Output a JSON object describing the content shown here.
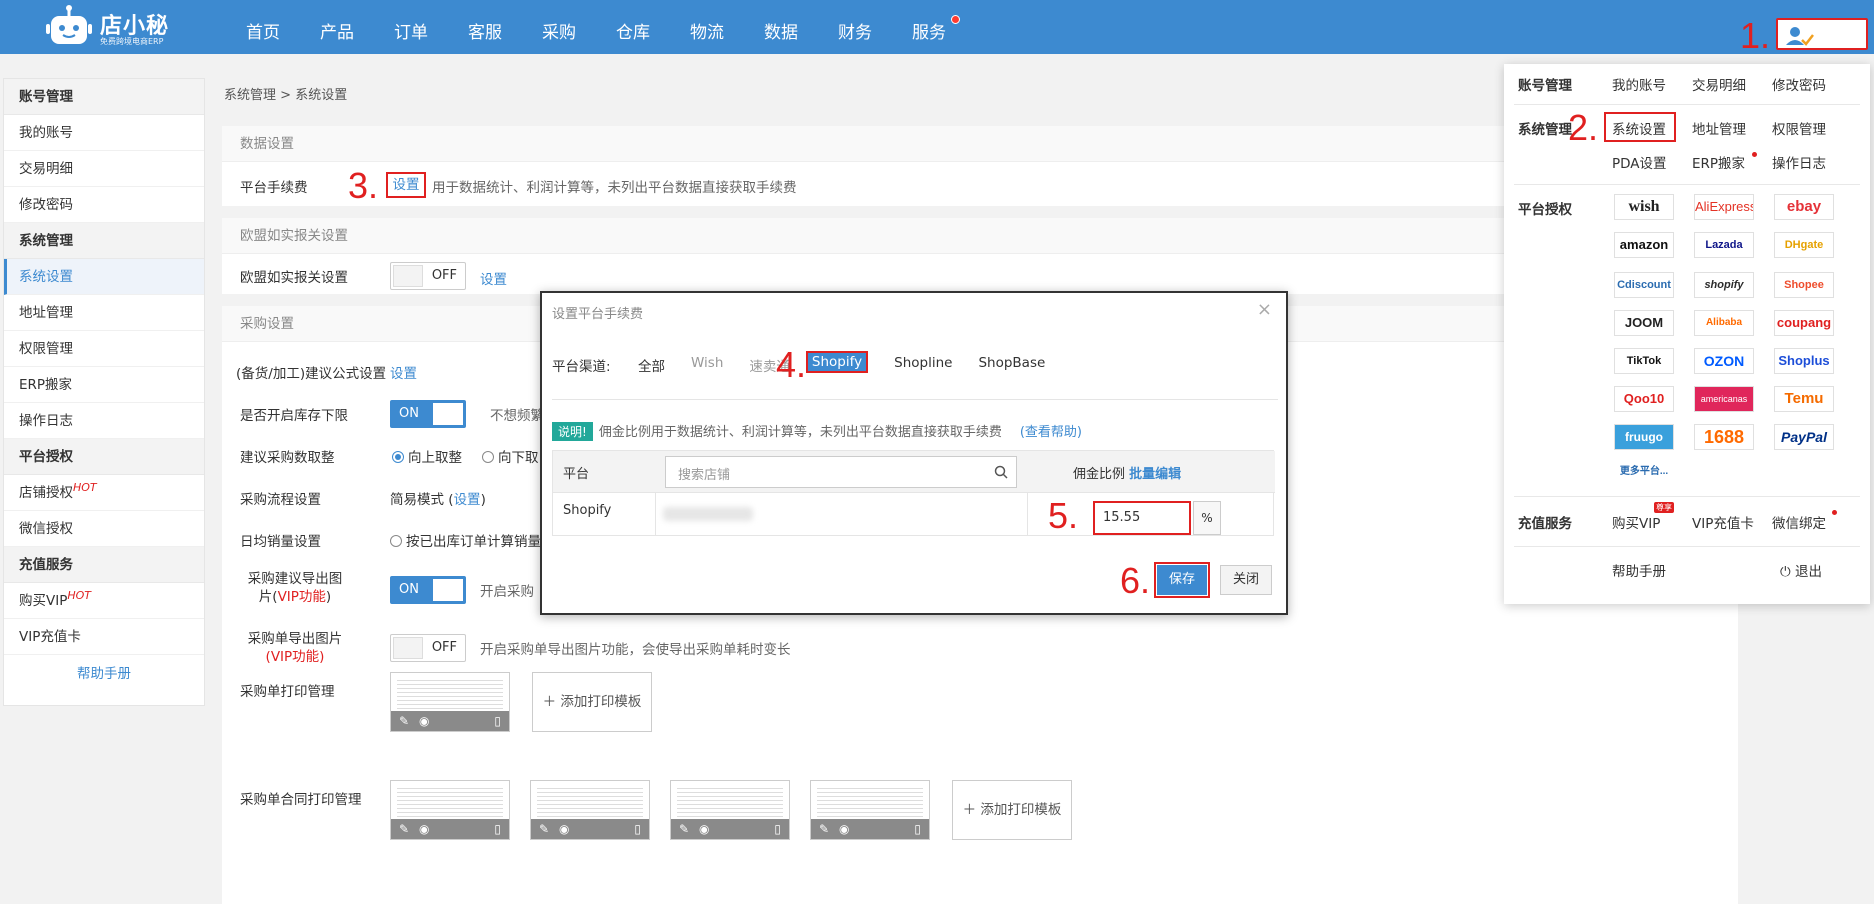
{
  "logo": {
    "brand": "店小秘",
    "sub": "免费跨境电商ERP"
  },
  "nav": [
    "首页",
    "产品",
    "订单",
    "客服",
    "采购",
    "仓库",
    "物流",
    "数据",
    "财务",
    "服务"
  ],
  "steps": [
    "1.",
    "2.",
    "3.",
    "4.",
    "5.",
    "6."
  ],
  "sidebar": {
    "groups": [
      {
        "title": "账号管理",
        "items": [
          "我的账号",
          "交易明细",
          "修改密码"
        ]
      },
      {
        "title": "系统管理",
        "items": [
          "系统设置",
          "地址管理",
          "权限管理",
          "ERP搬家",
          "操作日志"
        ]
      },
      {
        "title": "平台授权",
        "items": [
          "店铺授权",
          "微信授权"
        ]
      },
      {
        "title": "充值服务",
        "items": [
          "购买VIP",
          "VIP充值卡"
        ]
      }
    ],
    "hot": "HOT",
    "help": "帮助手册"
  },
  "breadcrumb": {
    "parent": "系统管理",
    "sep": ">",
    "current": "系统设置"
  },
  "data_settings": {
    "title": "数据设置",
    "fee_label": "平台手续费",
    "fee_link": "设置",
    "fee_desc": "用于数据统计、利润计算等，未列出平台数据直接获取手续费"
  },
  "eu_settings": {
    "title": "欧盟如实报关设置",
    "label": "欧盟如实报关设置",
    "toggle": "OFF",
    "link": "设置"
  },
  "purchase": {
    "title": "采购设置",
    "formula_label": "(备货/加工)建议公式设置",
    "formula_link": "设置",
    "stock_limit_label": "是否开启库存下限",
    "stock_limit_toggle": "ON",
    "stock_limit_desc": "不想频繁",
    "rounding_label": "建议采购数取整",
    "round_up": "向上取整",
    "round_down": "向下取",
    "flow_label": "采购流程设置",
    "flow_value": "简易模式 (",
    "flow_link": "设置",
    "flow_close": ")",
    "daily_label": "日均销量设置",
    "daily_option": "按已出库订单计算销量",
    "export_img_label_1": "采购建议导出图",
    "export_img_label_2": "片(",
    "export_img_vip": "VIP功能",
    "export_img_label_3": ")",
    "export_img_toggle": "ON",
    "export_img_desc": "开启采购",
    "order_img_label": "采购单导出图片",
    "order_img_vip": "(VIP功能)",
    "order_img_toggle": "OFF",
    "order_img_desc": "开启采购单导出图片功能，会使导出采购单耗时变长",
    "print_label": "采购单打印管理",
    "contract_label": "采购单合同打印管理",
    "add_template": "添加打印模板"
  },
  "modal": {
    "title": "设置平台手续费",
    "close": "×",
    "channel_label": "平台渠道:",
    "channels": [
      "全部",
      "Wish",
      "速卖通",
      "Shopify",
      "Shopline",
      "ShopBase"
    ],
    "active_channel": "Shopify",
    "note_tag": "说明!",
    "note_text": "佣金比例用于数据统计、利润计算等，未列出平台数据直接获取手续费",
    "note_help": "(查看帮助)",
    "col_platform": "平台",
    "search_placeholder": "搜索店铺",
    "col_rate": "佣金比例",
    "batch_edit": "批量编辑",
    "row_platform": "Shopify",
    "rate_value": "15.55",
    "pct": "%",
    "save": "保存",
    "close_btn": "关闭"
  },
  "dropdown": {
    "account_label": "账号管理",
    "account_links": [
      "我的账号",
      "交易明细",
      "修改密码"
    ],
    "system_label": "系统管理",
    "system_links": [
      "系统设置",
      "地址管理",
      "权限管理",
      "PDA设置",
      "ERP搬家",
      "操作日志"
    ],
    "platform_label": "平台授权",
    "platforms": [
      "wish",
      "AliExpress",
      "ebay",
      "amazon",
      "Lazada",
      "DHgate",
      "Cdiscount",
      "shopify",
      "Shopee",
      "JOOM",
      "Alibaba",
      "coupang",
      "TikTok",
      "OZON",
      "Shoplus",
      "Qoo10",
      "americanas",
      "Temu",
      "fruugo",
      "1688",
      "PayPal",
      "更多平台..."
    ],
    "recharge_label": "充值服务",
    "recharge_links": [
      "购买VIP",
      "VIP充值卡",
      "微信绑定"
    ],
    "vip_badge": "尊享",
    "help": "帮助手册",
    "logout": "退出"
  },
  "colors": {
    "primary": "#3d8ad0",
    "annotation": "#e02020"
  }
}
